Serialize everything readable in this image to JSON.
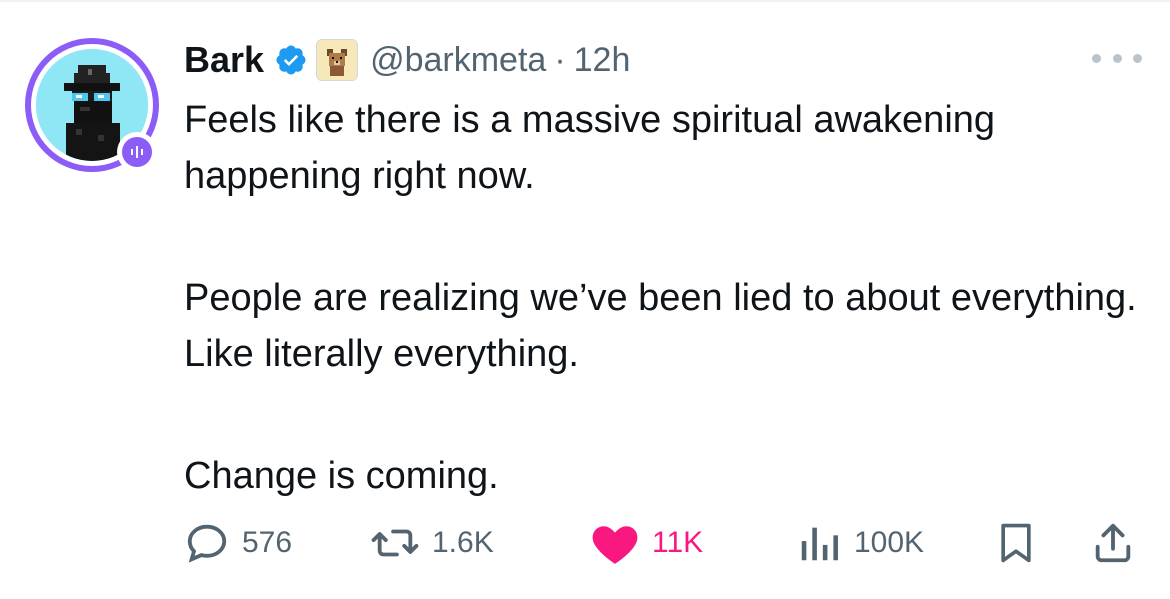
{
  "tweet": {
    "author_name": "Bark",
    "handle": "@barkmeta",
    "separator": "·",
    "time": "12h",
    "text": [
      "Feels like there is a massive spiritual awakening happening right now.",
      "People are realizing we’ve been lied to about everything. Like literally everything.",
      "Change is coming."
    ]
  },
  "actions": {
    "replies": "576",
    "reposts": "1.6K",
    "likes": "11K",
    "views": "100K"
  },
  "icons": {
    "verified": "verified-badge-icon",
    "affiliation": "dog-affiliation-icon",
    "more": "more-icon",
    "reply": "reply-icon",
    "repost": "repost-icon",
    "like": "heart-icon",
    "views": "views-icon",
    "bookmark": "bookmark-icon",
    "share": "share-icon"
  },
  "colors": {
    "verified_blue": "#1d9bf0",
    "like_pink": "#f91880",
    "secondary_text": "#536471",
    "avatar_ring": "#8b5cf6"
  }
}
